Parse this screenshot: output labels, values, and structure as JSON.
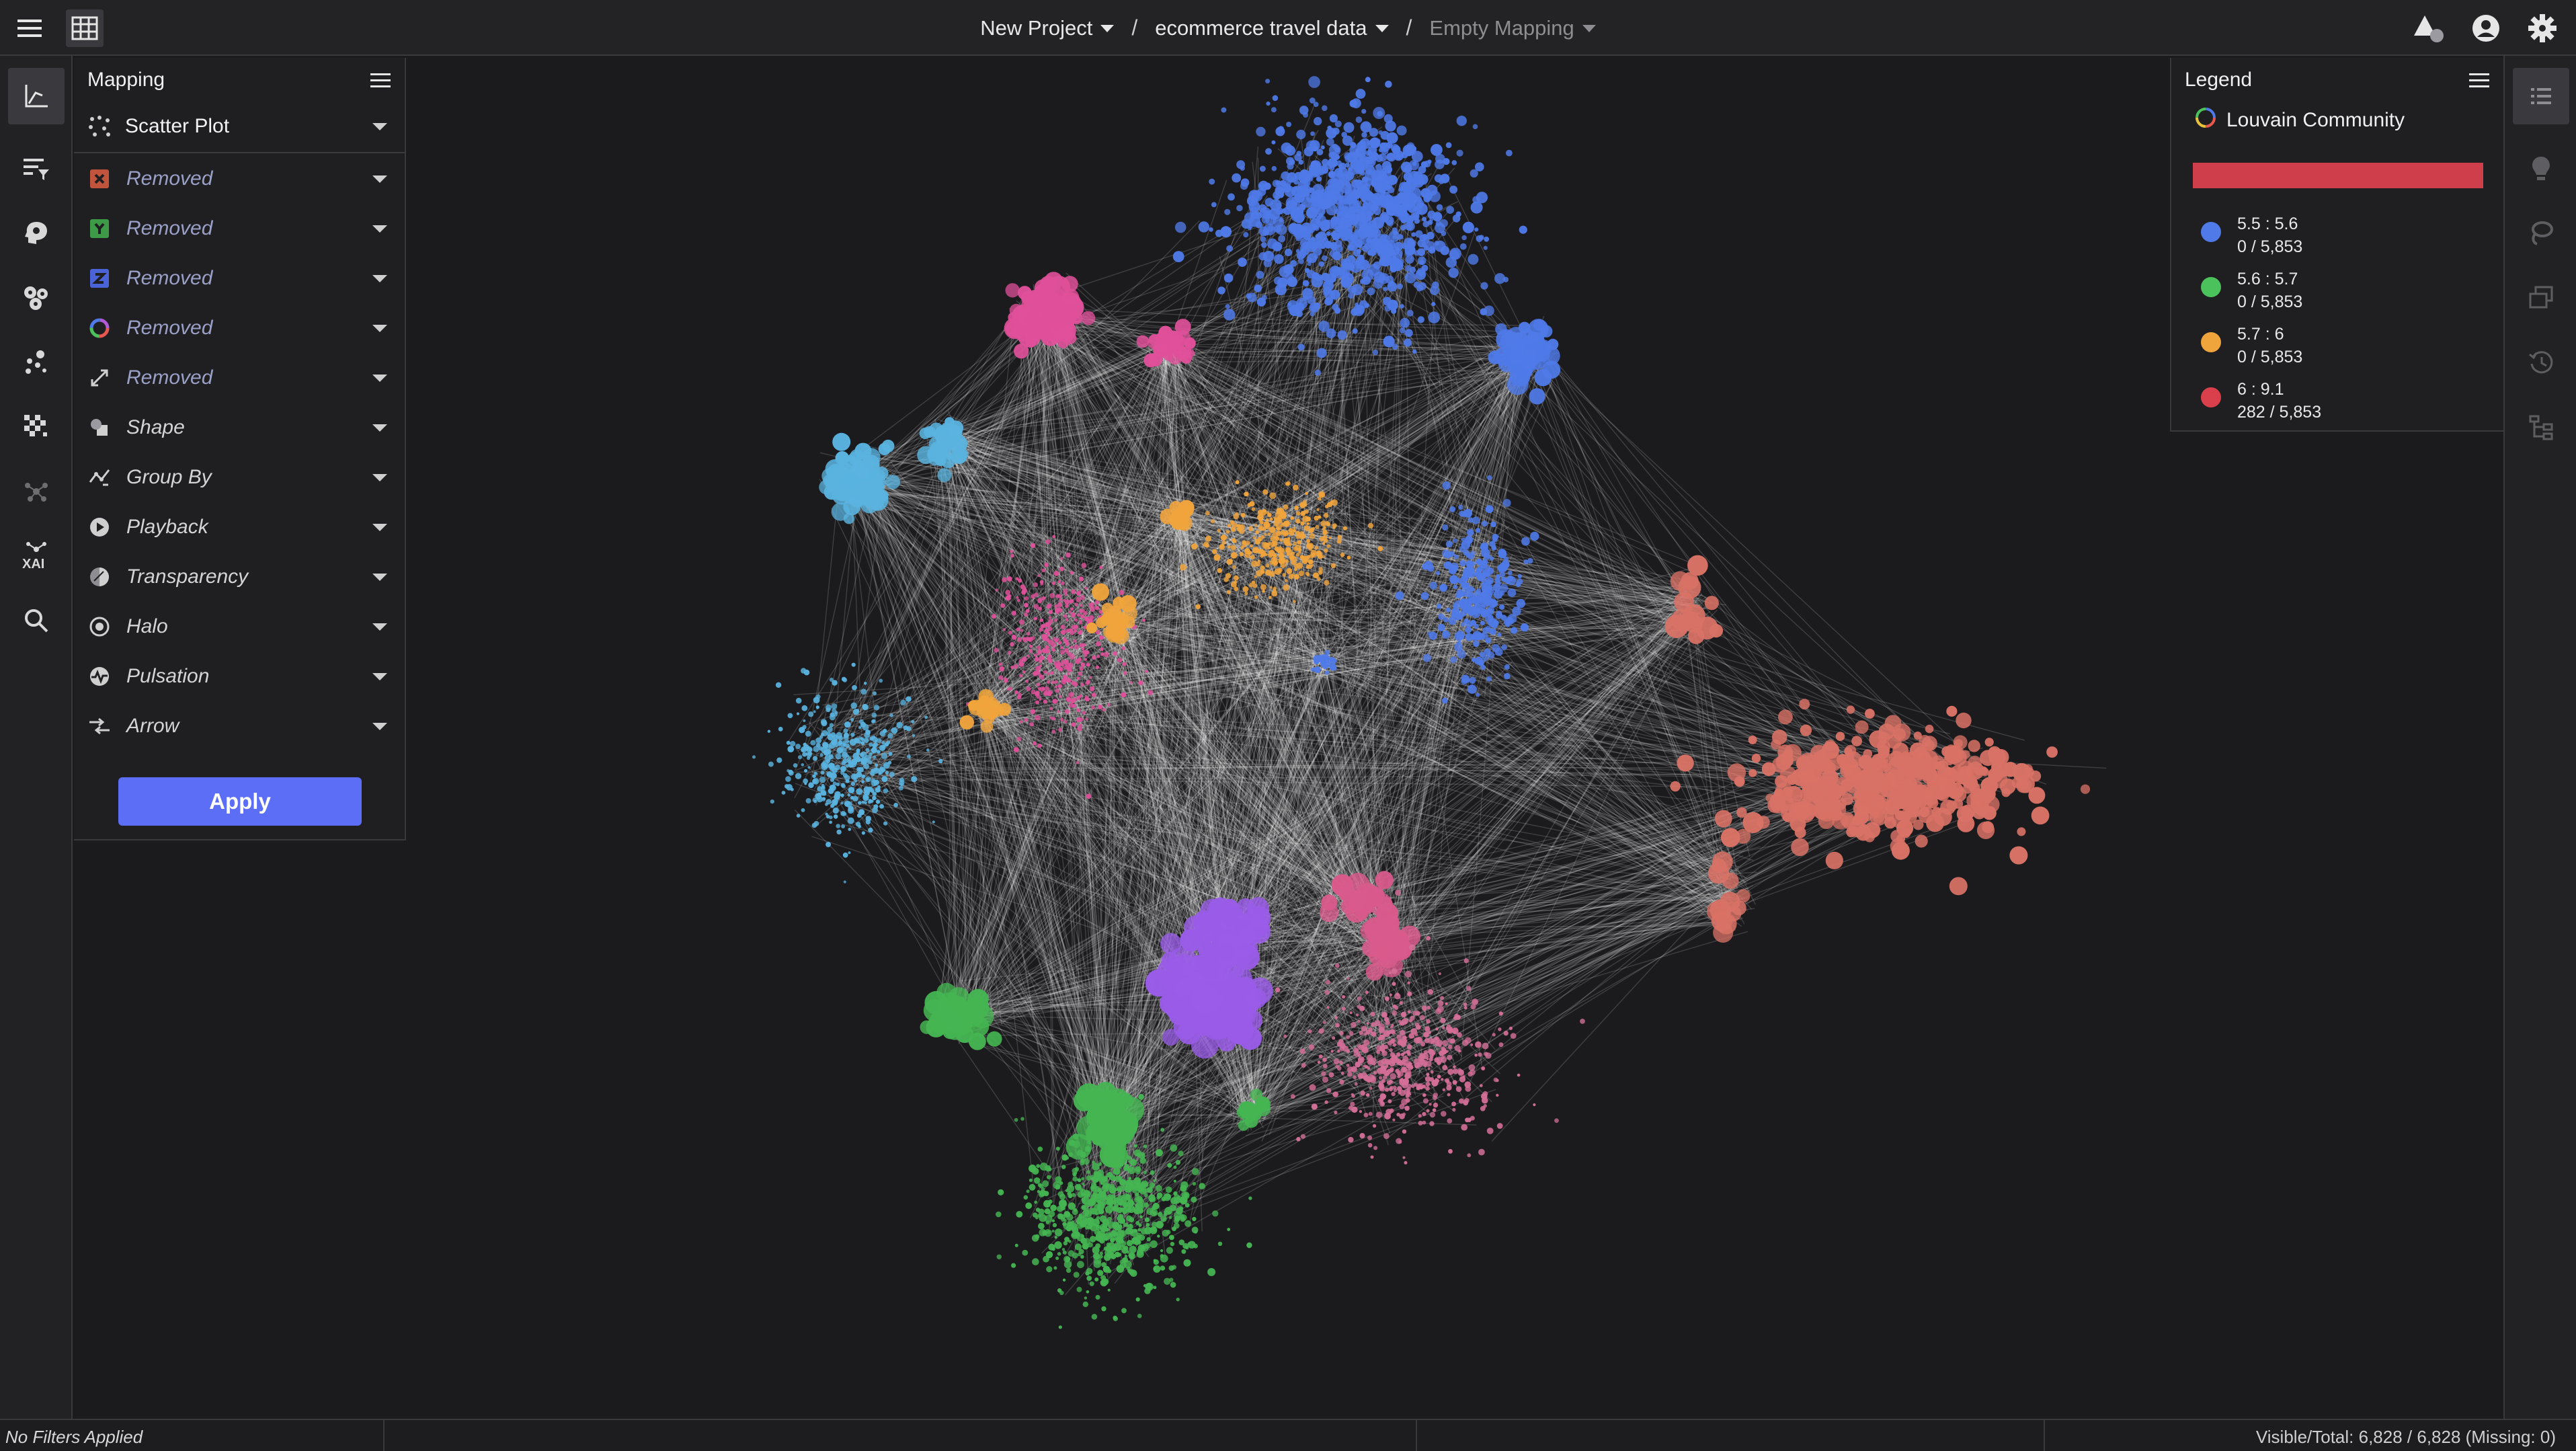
{
  "header": {
    "breadcrumb": [
      {
        "label": "New Project",
        "dim": false
      },
      {
        "label": "ecommerce travel data",
        "dim": false
      },
      {
        "label": "Empty Mapping",
        "dim": true
      }
    ],
    "separator": "/"
  },
  "mapping_panel": {
    "title": "Mapping",
    "plot_type": "Scatter Plot",
    "rows": [
      {
        "label": "Removed",
        "icon": "x-axis-icon",
        "removed": true
      },
      {
        "label": "Removed",
        "icon": "y-axis-icon",
        "removed": true
      },
      {
        "label": "Removed",
        "icon": "z-axis-icon",
        "removed": true
      },
      {
        "label": "Removed",
        "icon": "color-ring-icon",
        "removed": true
      },
      {
        "label": "Removed",
        "icon": "size-arrows-icon",
        "removed": true
      },
      {
        "label": "Shape",
        "icon": "shape-icon",
        "removed": false
      },
      {
        "label": "Group By",
        "icon": "group-by-icon",
        "removed": false
      },
      {
        "label": "Playback",
        "icon": "playback-icon",
        "removed": false
      },
      {
        "label": "Transparency",
        "icon": "transparency-icon",
        "removed": false
      },
      {
        "label": "Halo",
        "icon": "halo-icon",
        "removed": false
      },
      {
        "label": "Pulsation",
        "icon": "pulsation-icon",
        "removed": false
      },
      {
        "label": "Arrow",
        "icon": "arrow-icon",
        "removed": false
      }
    ],
    "apply_label": "Apply"
  },
  "legend": {
    "title": "Legend",
    "mapping_name": "Louvain Community",
    "bar_color": "#cf3f4b",
    "items": [
      {
        "range": "5.5 : 5.6",
        "count": "0 / 5,853",
        "color": "#4f7ae8"
      },
      {
        "range": "5.6 : 5.7",
        "count": "0 / 5,853",
        "color": "#4cc25c"
      },
      {
        "range": "5.7 : 6",
        "count": "0 / 5,853",
        "color": "#f0a43c"
      },
      {
        "range": "6 : 9.1",
        "count": "282 / 5,853",
        "color": "#d9404b"
      }
    ]
  },
  "status": {
    "filters": "No Filters Applied",
    "visible_total": "Visible/Total: 6,828 / 6,828 (Missing: 0)"
  },
  "colors": {
    "accent": "#5b6ef5",
    "background": "#1b1b1d",
    "panel": "#1f1f21"
  }
}
